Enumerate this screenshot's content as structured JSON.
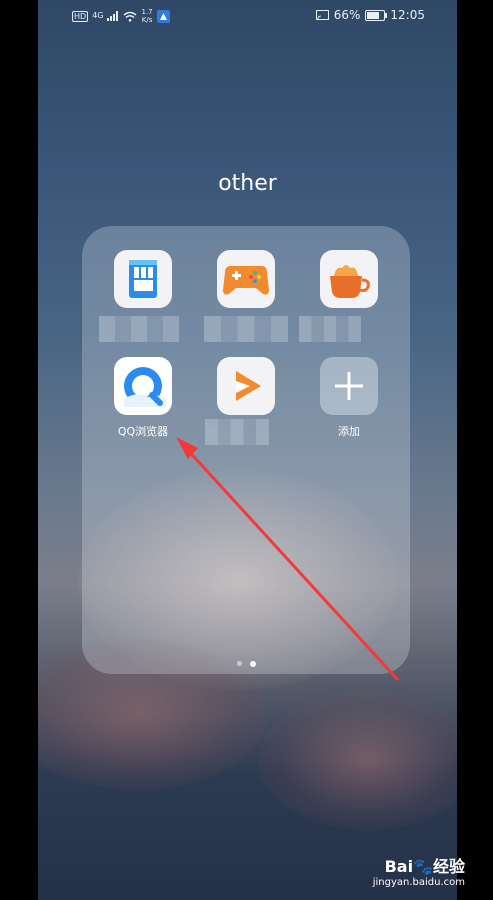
{
  "status_bar": {
    "hd": "HD",
    "network": "4G",
    "speed_value": "1.7",
    "speed_unit": "K/s",
    "battery": "66%",
    "time": "12:05"
  },
  "folder": {
    "title": "other",
    "apps": [
      {
        "name": "sim-card-app",
        "label": ""
      },
      {
        "name": "game-app",
        "label": ""
      },
      {
        "name": "cup-app",
        "label": ""
      },
      {
        "name": "qq-browser-app",
        "label": "QQ浏览器"
      },
      {
        "name": "video-app",
        "label": ""
      },
      {
        "name": "add-app",
        "label": "添加"
      }
    ],
    "page_count": 2,
    "current_page": 2
  },
  "watermark": {
    "brand": "Bai🐾经验",
    "url": "jingyan.baidu.com"
  },
  "colors": {
    "accent_arrow": "#f23a3a",
    "qq_blue": "#2a8cf0",
    "game_orange": "#f28a2e",
    "cup_orange": "#e8702a"
  }
}
